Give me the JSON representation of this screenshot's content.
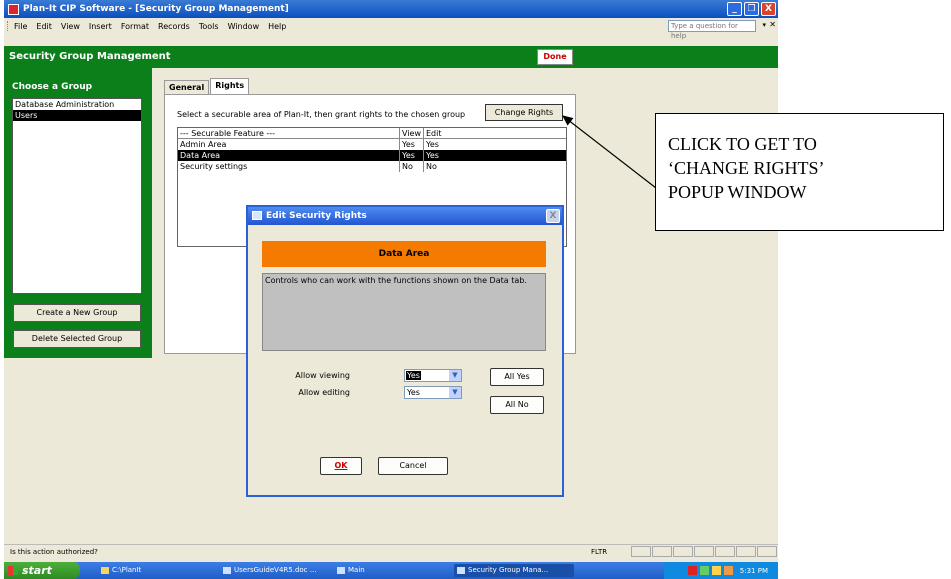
{
  "window": {
    "title": "Plan-It CIP Software - [Security Group Management]",
    "minimize": "_",
    "restore": "❐",
    "close": "X"
  },
  "menubar": {
    "items": [
      "File",
      "Edit",
      "View",
      "Insert",
      "Format",
      "Records",
      "Tools",
      "Window",
      "Help"
    ],
    "help_placeholder": "Type a question for help"
  },
  "header": {
    "title": "Security Group Management",
    "done_label": "Done"
  },
  "left_panel": {
    "choose_label": "Choose a Group",
    "groups": [
      {
        "label": "Database Administration",
        "selected": false
      },
      {
        "label": "Users",
        "selected": true
      }
    ],
    "create_button": "Create a New Group",
    "delete_button": "Delete Selected Group"
  },
  "tabs": [
    {
      "label": "General",
      "active": false
    },
    {
      "label": "Rights",
      "active": true
    }
  ],
  "rights_tab": {
    "instruction": "Select a securable area of Plan-It, then grant rights to the chosen group",
    "change_button": "Change Rights",
    "columns": [
      "--- Securable Feature ---",
      "View",
      "Edit"
    ],
    "rows": [
      {
        "feature": "Admin Area",
        "view": "Yes",
        "edit": "Yes",
        "selected": false
      },
      {
        "feature": "Data Area",
        "view": "Yes",
        "edit": "Yes",
        "selected": true
      },
      {
        "feature": "Security settings",
        "view": "No",
        "edit": "No",
        "selected": false
      }
    ]
  },
  "dialog": {
    "title": "Edit Security Rights",
    "area_name": "Data Area",
    "description": "Controls who can work with the functions shown on the Data tab.",
    "allow_viewing_label": "Allow viewing",
    "allow_viewing_value": "Yes",
    "allow_editing_label": "Allow editing",
    "allow_editing_value": "Yes",
    "all_yes": "All Yes",
    "all_no": "All No",
    "ok": "OK",
    "cancel": "Cancel",
    "close": "X"
  },
  "status": {
    "text": "Is this action authorized?",
    "mode": "FLTR"
  },
  "taskbar": {
    "start": "start",
    "items": [
      {
        "label": "C:\\PlanIt"
      },
      {
        "label": "UsersGuideV4R5.doc ..."
      },
      {
        "label": "Main"
      },
      {
        "label": "Security Group Mana..."
      }
    ],
    "clock": "5:31 PM"
  },
  "callout": {
    "lines": [
      "CLICK TO GET TO",
      "‘CHANGE RIGHTS’",
      "POPUP WINDOW"
    ]
  },
  "colors": {
    "header_green": "#0b7f1a",
    "banner_orange": "#f47b00",
    "done_red": "#cc0000",
    "titlebar_blue": "#0a4fc0"
  }
}
